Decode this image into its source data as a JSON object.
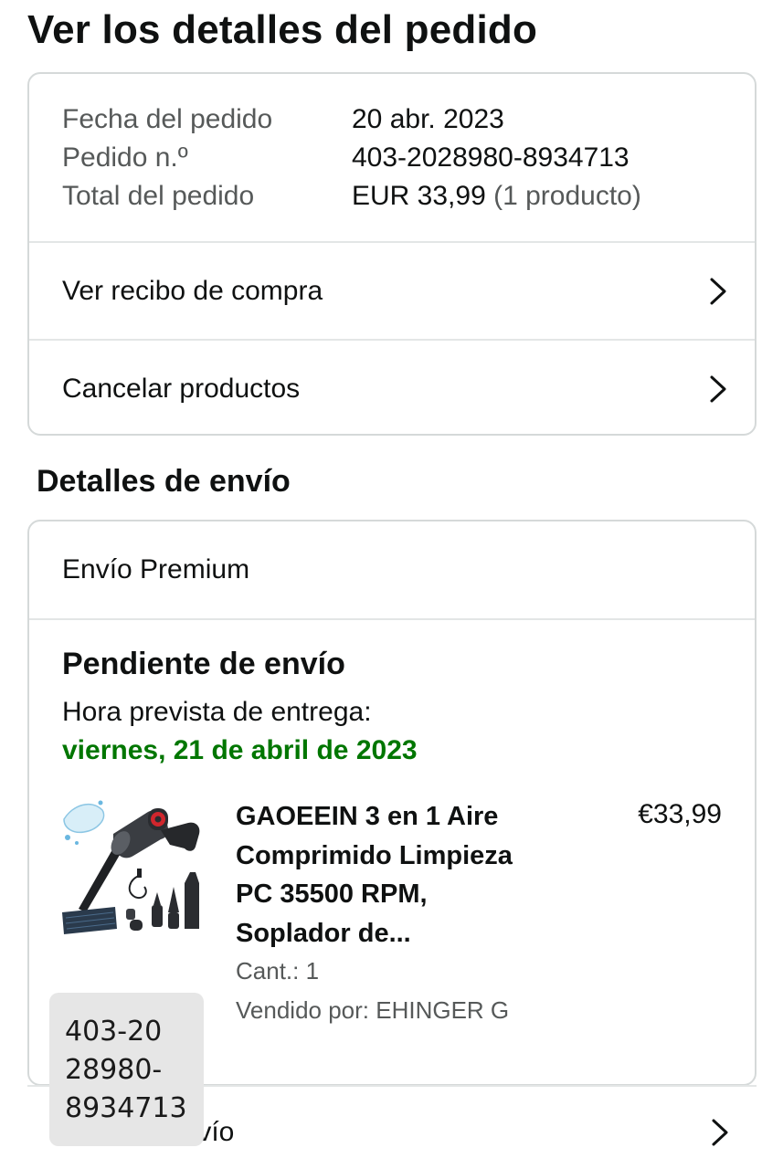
{
  "page": {
    "title": "Ver los detalles del pedido"
  },
  "summary": {
    "order_date_label": "Fecha del pedido",
    "order_date_value": "20 abr. 2023",
    "order_number_label": "Pedido n.º",
    "order_number_value": "403-2028980-8934713",
    "order_total_label": "Total del pedido",
    "order_total_value": "EUR 33,99",
    "order_total_count": "(1 producto)"
  },
  "links": {
    "receipt": "Ver recibo de compra",
    "cancel": "Cancelar productos"
  },
  "shipping": {
    "section_title": "Detalles de envío",
    "method": "Envío Premium",
    "status": "Pendiente de envío",
    "eta_label": "Hora prevista de entrega:",
    "eta_date": "viernes, 21 de abril de 2023",
    "eta_color": "#007600"
  },
  "product": {
    "title": "GAOEEIN 3 en 1 Aire Comprimido Limpieza PC 35500 RPM, Soplador de...",
    "price": "€33,99",
    "quantity": "Cant.: 1",
    "seller": "Vendido por: EHINGER G",
    "image_icon": "air-duster-product-image"
  },
  "bottom_row": {
    "label_visible": "ıvío"
  },
  "tooltip": {
    "line1": "403-20",
    "line2": "28980-",
    "line3": "8934713"
  },
  "icons": {
    "chevron": "chevron-right-icon"
  }
}
